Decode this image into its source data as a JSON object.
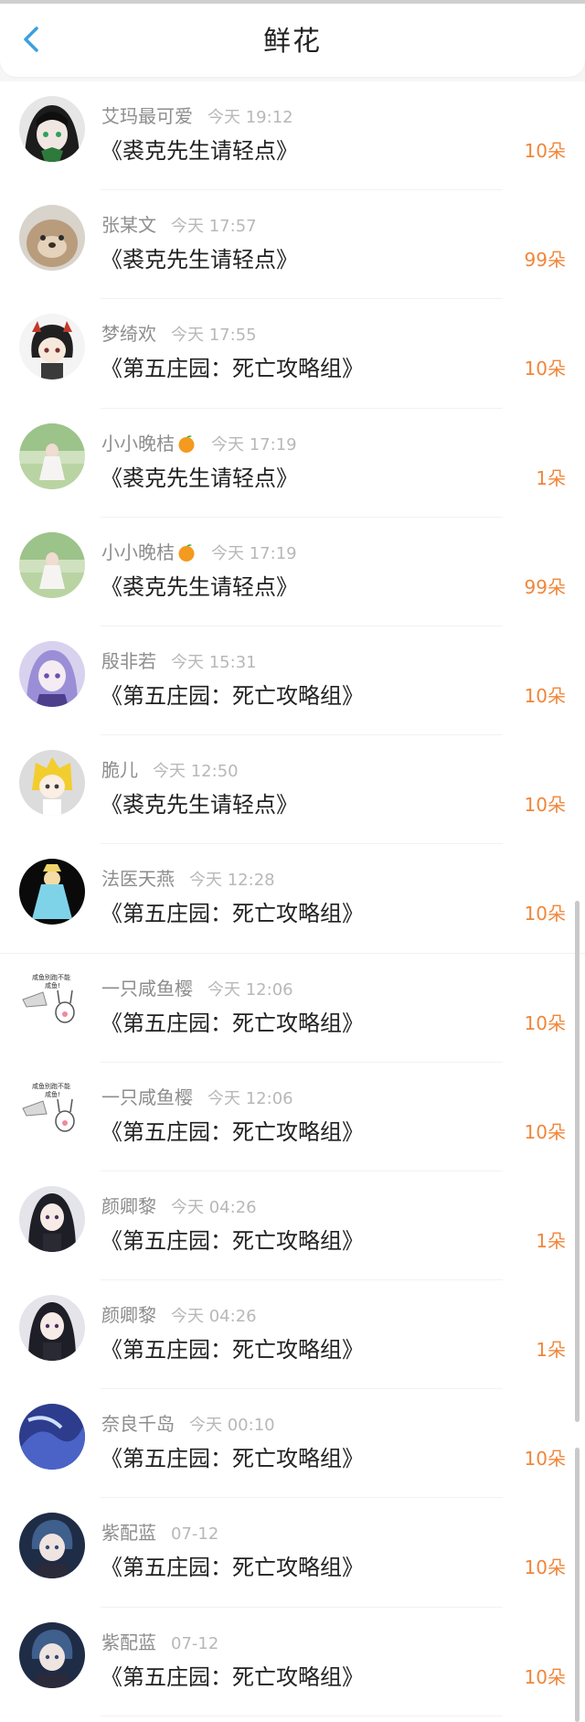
{
  "header": {
    "title": "鲜花"
  },
  "colors": {
    "accent_back": "#3ba0e0",
    "count": "#f0863a"
  },
  "items": [
    {
      "user": "艾玛最可爱",
      "time": "今天 19:12",
      "book": "《裘克先生请轻点》",
      "count": "10朵",
      "avatar_icon": "anime-green-hair-avatar"
    },
    {
      "user": "张某文",
      "time": "今天 17:57",
      "book": "《裘克先生请轻点》",
      "count": "99朵",
      "avatar_icon": "otter-avatar"
    },
    {
      "user": "梦绮欢",
      "time": "今天 17:55",
      "book": "《第五庄园：死亡攻略组》",
      "count": "10朵",
      "avatar_icon": "chibi-black-hair-avatar"
    },
    {
      "user": "小小晚桔",
      "emoji": "orange",
      "time": "今天 17:19",
      "book": "《裘克先生请轻点》",
      "count": "1朵",
      "avatar_icon": "girl-in-park-avatar"
    },
    {
      "user": "小小晚桔",
      "emoji": "orange",
      "time": "今天 17:19",
      "book": "《裘克先生请轻点》",
      "count": "99朵",
      "avatar_icon": "girl-in-park-avatar"
    },
    {
      "user": "殷非若",
      "time": "今天 15:31",
      "book": "《第五庄园：死亡攻略组》",
      "count": "10朵",
      "avatar_icon": "purple-anime-avatar"
    },
    {
      "user": "脆儿",
      "time": "今天 12:50",
      "book": "《裘克先生请轻点》",
      "count": "10朵",
      "avatar_icon": "blonde-chibi-avatar"
    },
    {
      "user": "法医天燕",
      "time": "今天 12:28",
      "book": "《第五庄园：死亡攻略组》",
      "count": "10朵",
      "avatar_icon": "blue-dress-avatar"
    },
    {
      "user": "一只咸鱼樱",
      "time": "今天 12:06",
      "book": "《第五庄园：死亡攻略组》",
      "count": "10朵",
      "avatar_icon": "sticker-rabbit-avatar",
      "sticker_text": "咸鱼别跑不能\n咸鱼!"
    },
    {
      "user": "一只咸鱼樱",
      "time": "今天 12:06",
      "book": "《第五庄园：死亡攻略组》",
      "count": "10朵",
      "avatar_icon": "sticker-rabbit-avatar",
      "sticker_text": "咸鱼别跑不能\n咸鱼!"
    },
    {
      "user": "颜卿黎",
      "time": "今天 04:26",
      "book": "《第五庄园：死亡攻略组》",
      "count": "1朵",
      "avatar_icon": "dark-hair-girl-avatar"
    },
    {
      "user": "颜卿黎",
      "time": "今天 04:26",
      "book": "《第五庄园：死亡攻略组》",
      "count": "1朵",
      "avatar_icon": "dark-hair-girl-avatar"
    },
    {
      "user": "奈良千岛",
      "time": "今天 00:10",
      "book": "《第五庄园：死亡攻略组》",
      "count": "10朵",
      "avatar_icon": "blue-abstract-avatar"
    },
    {
      "user": "紫配蓝",
      "time": "07-12",
      "book": "《第五庄园：死亡攻略组》",
      "count": "10朵",
      "avatar_icon": "anime-boy-avatar"
    },
    {
      "user": "紫配蓝",
      "time": "07-12",
      "book": "《第五庄园：死亡攻略组》",
      "count": "10朵",
      "avatar_icon": "anime-boy-avatar"
    }
  ]
}
